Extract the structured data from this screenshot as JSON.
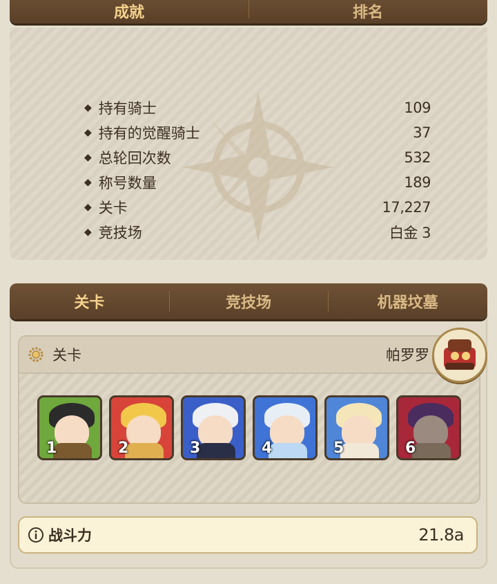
{
  "top_tabs": [
    {
      "label": "成就",
      "active": true
    },
    {
      "label": "排名",
      "active": false
    }
  ],
  "stats": [
    {
      "label": "持有骑士",
      "value": "109"
    },
    {
      "label": "持有的觉醒骑士",
      "value": "37"
    },
    {
      "label": "总轮回次数",
      "value": "532"
    },
    {
      "label": "称号数量",
      "value": "189"
    },
    {
      "label": "关卡",
      "value": "17,227"
    },
    {
      "label": "竞技场",
      "value": "白金 3"
    }
  ],
  "bullet": "◆",
  "mode_tabs": [
    {
      "label": "关卡",
      "active": true
    },
    {
      "label": "竞技场",
      "active": false
    },
    {
      "label": "机器坟墓",
      "active": false
    }
  ],
  "stage": {
    "title": "关卡",
    "icon": "gear-icon",
    "leader_name": "帕罗罗",
    "team": [
      {
        "slot": "1",
        "bg": "#6fa83c",
        "hair": "#2b2b2b",
        "outfit": "#7a5a2e"
      },
      {
        "slot": "2",
        "bg": "#d8443a",
        "hair": "#f2c84a",
        "outfit": "#e0b050"
      },
      {
        "slot": "3",
        "bg": "#3a5fc8",
        "hair": "#eef0f4",
        "outfit": "#2a2f48"
      },
      {
        "slot": "4",
        "bg": "#3f73d6",
        "hair": "#e8eef6",
        "outfit": "#bcd8f4"
      },
      {
        "slot": "5",
        "bg": "#4f86d8",
        "hair": "#f4e6b8",
        "outfit": "#f2e8d8"
      },
      {
        "slot": "6",
        "bg": "#a8283a",
        "hair": "#4a2c5e",
        "outfit": "#7a6a5a"
      }
    ]
  },
  "power": {
    "icon": "info-icon",
    "label": "战斗力",
    "value": "21.8a"
  }
}
